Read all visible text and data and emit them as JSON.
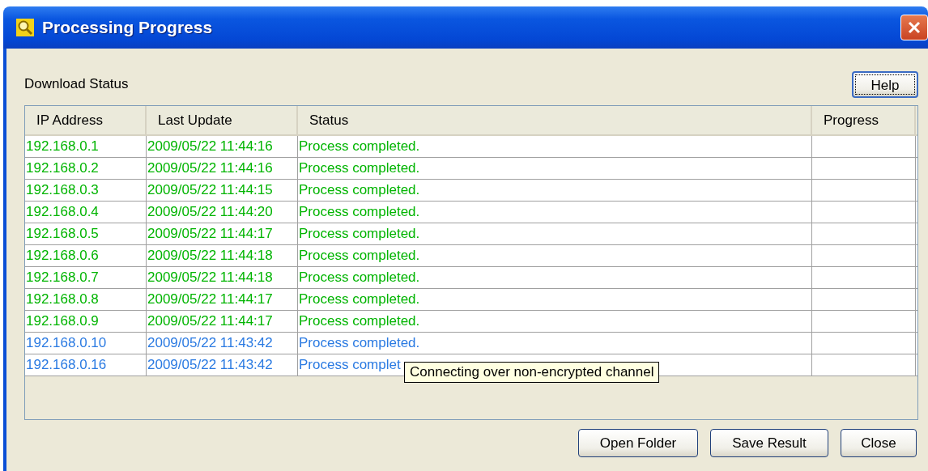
{
  "window": {
    "title": "Processing Progress"
  },
  "section_label": "Download Status",
  "help_button": "Help",
  "table": {
    "columns": [
      "IP Address",
      "Last Update",
      "Status",
      "Progress"
    ],
    "rows": [
      {
        "ip": "192.168.0.1",
        "last_update": "2009/05/22 11:44:16",
        "status": "Process completed.",
        "color": "#00b400"
      },
      {
        "ip": "192.168.0.2",
        "last_update": "2009/05/22 11:44:16",
        "status": "Process completed.",
        "color": "#00b400"
      },
      {
        "ip": "192.168.0.3",
        "last_update": "2009/05/22 11:44:15",
        "status": "Process completed.",
        "color": "#00b400"
      },
      {
        "ip": "192.168.0.4",
        "last_update": "2009/05/22 11:44:20",
        "status": "Process completed.",
        "color": "#00b400"
      },
      {
        "ip": "192.168.0.5",
        "last_update": "2009/05/22 11:44:17",
        "status": "Process completed.",
        "color": "#00b400"
      },
      {
        "ip": "192.168.0.6",
        "last_update": "2009/05/22 11:44:18",
        "status": "Process completed.",
        "color": "#00b400"
      },
      {
        "ip": "192.168.0.7",
        "last_update": "2009/05/22 11:44:18",
        "status": "Process completed.",
        "color": "#00b400"
      },
      {
        "ip": "192.168.0.8",
        "last_update": "2009/05/22 11:44:17",
        "status": "Process completed.",
        "color": "#00b400"
      },
      {
        "ip": "192.168.0.9",
        "last_update": "2009/05/22 11:44:17",
        "status": "Process completed.",
        "color": "#00b400"
      },
      {
        "ip": "192.168.0.10",
        "last_update": "2009/05/22 11:43:42",
        "status": "Process completed.",
        "color": "#2a7ae2"
      },
      {
        "ip": "192.168.0.16",
        "last_update": "2009/05/22 11:43:42",
        "status": "Process complet",
        "color": "#2a7ae2"
      }
    ]
  },
  "tooltip": "Connecting over non-encrypted channel",
  "buttons": [
    "Open Folder",
    "Save Result",
    "Close"
  ]
}
